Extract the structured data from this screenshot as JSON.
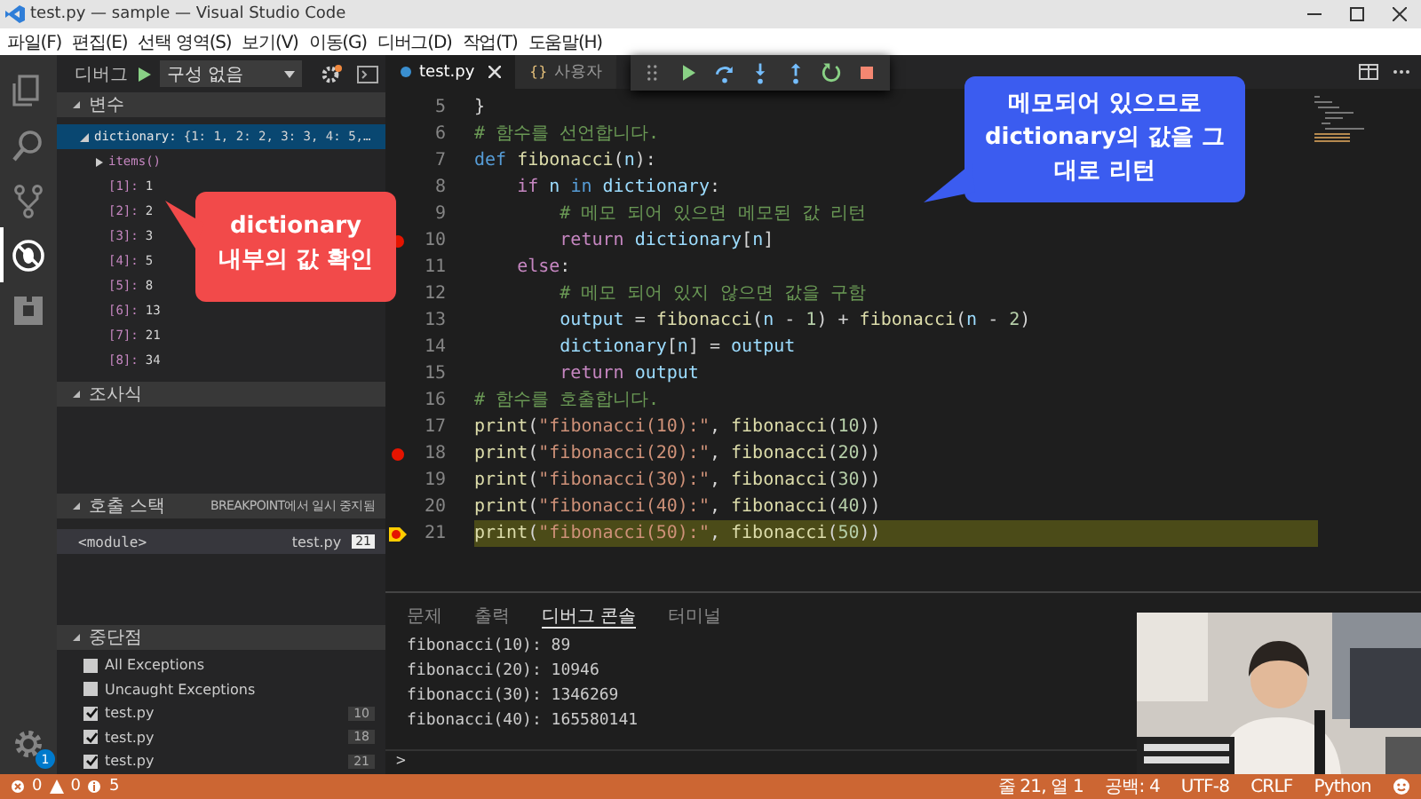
{
  "window": {
    "title": "test.py — sample — Visual Studio Code"
  },
  "menu": [
    "파일(F)",
    "편집(E)",
    "선택 영역(S)",
    "보기(V)",
    "이동(G)",
    "디버그(D)",
    "작업(T)",
    "도움말(H)"
  ],
  "activity_bar": {
    "items": [
      {
        "kind": "explorer",
        "selected": false
      },
      {
        "kind": "search",
        "selected": false
      },
      {
        "kind": "source-control",
        "selected": false
      },
      {
        "kind": "debug",
        "selected": true
      },
      {
        "kind": "extensions",
        "selected": false
      }
    ],
    "settings_badge": "1"
  },
  "debug_sidebar": {
    "label": "디버그",
    "configuration": "구성 없음",
    "variables": {
      "title": "변수",
      "items": [
        {
          "name": "dictionary:",
          "value": "{1: 1, 2: 2, 3: 3, 4: 5,…",
          "expanded": true,
          "selected": true,
          "children": [
            {
              "name": "items()",
              "expanded": false,
              "selected": false
            },
            {
              "name": "[1]:",
              "value": "1",
              "selected": false
            },
            {
              "name": "[2]:",
              "value": "2",
              "selected": false
            },
            {
              "name": "[3]:",
              "value": "3",
              "selected": false
            },
            {
              "name": "[4]:",
              "value": "5",
              "selected": false
            },
            {
              "name": "[5]:",
              "value": "8",
              "selected": false
            },
            {
              "name": "[6]:",
              "value": "13",
              "selected": false
            },
            {
              "name": "[7]:",
              "value": "21",
              "selected": false
            },
            {
              "name": "[8]:",
              "value": "34",
              "selected": false
            }
          ]
        }
      ]
    },
    "watch": {
      "title": "조사식"
    },
    "call_stack": {
      "title": "호출 스택",
      "status": "BREAKPOINT에서 일시 중지됨",
      "frames": [
        {
          "name": "<module>",
          "file": "test.py",
          "line": "21",
          "selected": true
        }
      ]
    },
    "breakpoints": {
      "title": "중단점",
      "items": [
        {
          "label": "All Exceptions",
          "checked": false
        },
        {
          "label": "Uncaught Exceptions",
          "checked": false
        },
        {
          "label": "test.py",
          "line": "10",
          "checked": true
        },
        {
          "label": "test.py",
          "line": "18",
          "checked": true
        },
        {
          "label": "test.py",
          "line": "21",
          "checked": true
        }
      ]
    }
  },
  "editor": {
    "tabs": [
      {
        "label": "test.py",
        "kind": "python-file",
        "selected": true
      },
      {
        "label": "사용자",
        "kind": "settings-file",
        "glyph": "{}",
        "selected": false
      }
    ],
    "debug_toolbar": [
      {
        "kind": "grip"
      },
      {
        "kind": "continue"
      },
      {
        "kind": "step-over"
      },
      {
        "kind": "step-into"
      },
      {
        "kind": "step-out"
      },
      {
        "kind": "restart"
      },
      {
        "kind": "stop"
      }
    ],
    "lines": [
      {
        "number": "5",
        "breakpoint": false,
        "current": false,
        "tokens": [
          {
            "kind": "plain",
            "text": "}"
          }
        ]
      },
      {
        "number": "6",
        "breakpoint": false,
        "current": false,
        "tokens": [
          {
            "kind": "comment",
            "text": "# 함수를 선언합니다."
          }
        ]
      },
      {
        "number": "7",
        "breakpoint": false,
        "current": false,
        "tokens": [
          {
            "kind": "storage",
            "text": "def"
          },
          {
            "kind": "function",
            "text": " fibonacci"
          },
          {
            "kind": "plain",
            "text": "("
          },
          {
            "kind": "variable",
            "text": "n"
          },
          {
            "kind": "plain",
            "text": "):"
          }
        ]
      },
      {
        "number": "8",
        "breakpoint": false,
        "current": false,
        "tokens": [
          {
            "kind": "keyword",
            "text": "    if"
          },
          {
            "kind": "variable",
            "text": " n"
          },
          {
            "kind": "storage",
            "text": " in"
          },
          {
            "kind": "variable",
            "text": " dictionary"
          },
          {
            "kind": "plain",
            "text": ":"
          }
        ]
      },
      {
        "number": "9",
        "breakpoint": false,
        "current": false,
        "tokens": [
          {
            "kind": "comment",
            "text": "        # 메모 되어 있으면 메모된 값 리턴"
          }
        ]
      },
      {
        "number": "10",
        "breakpoint": true,
        "current": false,
        "tokens": [
          {
            "kind": "keyword",
            "text": "        return"
          },
          {
            "kind": "variable",
            "text": " dictionary"
          },
          {
            "kind": "plain",
            "text": "["
          },
          {
            "kind": "variable",
            "text": "n"
          },
          {
            "kind": "plain",
            "text": "]"
          }
        ]
      },
      {
        "number": "11",
        "breakpoint": false,
        "current": false,
        "tokens": [
          {
            "kind": "keyword",
            "text": "    else"
          },
          {
            "kind": "plain",
            "text": ":"
          }
        ]
      },
      {
        "number": "12",
        "breakpoint": false,
        "current": false,
        "tokens": [
          {
            "kind": "comment",
            "text": "        # 메모 되어 있지 않으면 값을 구함"
          }
        ]
      },
      {
        "number": "13",
        "breakpoint": false,
        "current": false,
        "tokens": [
          {
            "kind": "variable",
            "text": "        output"
          },
          {
            "kind": "plain",
            "text": " = "
          },
          {
            "kind": "function",
            "text": "fibonacci"
          },
          {
            "kind": "plain",
            "text": "("
          },
          {
            "kind": "variable",
            "text": "n"
          },
          {
            "kind": "plain",
            "text": " - "
          },
          {
            "kind": "number",
            "text": "1"
          },
          {
            "kind": "plain",
            "text": ") + "
          },
          {
            "kind": "function",
            "text": "fibonacci"
          },
          {
            "kind": "plain",
            "text": "("
          },
          {
            "kind": "variable",
            "text": "n"
          },
          {
            "kind": "plain",
            "text": " - "
          },
          {
            "kind": "number",
            "text": "2"
          },
          {
            "kind": "plain",
            "text": ")"
          }
        ]
      },
      {
        "number": "14",
        "breakpoint": false,
        "current": false,
        "tokens": [
          {
            "kind": "variable",
            "text": "        dictionary"
          },
          {
            "kind": "plain",
            "text": "["
          },
          {
            "kind": "variable",
            "text": "n"
          },
          {
            "kind": "plain",
            "text": "] = "
          },
          {
            "kind": "variable",
            "text": "output"
          }
        ]
      },
      {
        "number": "15",
        "breakpoint": false,
        "current": false,
        "tokens": [
          {
            "kind": "keyword",
            "text": "        return"
          },
          {
            "kind": "variable",
            "text": " output"
          }
        ]
      },
      {
        "number": "16",
        "breakpoint": false,
        "current": false,
        "tokens": [
          {
            "kind": "comment",
            "text": "# 함수를 호출합니다."
          }
        ]
      },
      {
        "number": "17",
        "breakpoint": false,
        "current": false,
        "tokens": [
          {
            "kind": "function",
            "text": "print"
          },
          {
            "kind": "plain",
            "text": "("
          },
          {
            "kind": "string",
            "text": "\"fibonacci(10):\""
          },
          {
            "kind": "plain",
            "text": ", "
          },
          {
            "kind": "function",
            "text": "fibonacci"
          },
          {
            "kind": "plain",
            "text": "("
          },
          {
            "kind": "number",
            "text": "10"
          },
          {
            "kind": "plain",
            "text": "))"
          }
        ]
      },
      {
        "number": "18",
        "breakpoint": true,
        "current": false,
        "tokens": [
          {
            "kind": "function",
            "text": "print"
          },
          {
            "kind": "plain",
            "text": "("
          },
          {
            "kind": "string",
            "text": "\"fibonacci(20):\""
          },
          {
            "kind": "plain",
            "text": ", "
          },
          {
            "kind": "function",
            "text": "fibonacci"
          },
          {
            "kind": "plain",
            "text": "("
          },
          {
            "kind": "number",
            "text": "20"
          },
          {
            "kind": "plain",
            "text": "))"
          }
        ]
      },
      {
        "number": "19",
        "breakpoint": false,
        "current": false,
        "tokens": [
          {
            "kind": "function",
            "text": "print"
          },
          {
            "kind": "plain",
            "text": "("
          },
          {
            "kind": "string",
            "text": "\"fibonacci(30):\""
          },
          {
            "kind": "plain",
            "text": ", "
          },
          {
            "kind": "function",
            "text": "fibonacci"
          },
          {
            "kind": "plain",
            "text": "("
          },
          {
            "kind": "number",
            "text": "30"
          },
          {
            "kind": "plain",
            "text": "))"
          }
        ]
      },
      {
        "number": "20",
        "breakpoint": false,
        "current": false,
        "tokens": [
          {
            "kind": "function",
            "text": "print"
          },
          {
            "kind": "plain",
            "text": "("
          },
          {
            "kind": "string",
            "text": "\"fibonacci(40):\""
          },
          {
            "kind": "plain",
            "text": ", "
          },
          {
            "kind": "function",
            "text": "fibonacci"
          },
          {
            "kind": "plain",
            "text": "("
          },
          {
            "kind": "number",
            "text": "40"
          },
          {
            "kind": "plain",
            "text": "))"
          }
        ]
      },
      {
        "number": "21",
        "breakpoint": true,
        "current": true,
        "tokens": [
          {
            "kind": "function",
            "text": "print"
          },
          {
            "kind": "plain",
            "text": "("
          },
          {
            "kind": "string",
            "text": "\"fibonacci(50):\""
          },
          {
            "kind": "plain",
            "text": ", "
          },
          {
            "kind": "function",
            "text": "fibonacci"
          },
          {
            "kind": "plain",
            "text": "("
          },
          {
            "kind": "number",
            "text": "50"
          },
          {
            "kind": "plain",
            "text": "))"
          }
        ]
      }
    ]
  },
  "annotations": [
    {
      "text": "dictionary\n내부의 값 확인",
      "color": "#f24a4a"
    },
    {
      "text": "메모되어 있으므로\ndictionary의 값을 그\n대로 리턴",
      "color": "#3b5cf0"
    }
  ],
  "panel": {
    "tabs": [
      {
        "label": "문제",
        "selected": false
      },
      {
        "label": "출력",
        "selected": false
      },
      {
        "label": "디버그 콘솔",
        "selected": true
      },
      {
        "label": "터미널",
        "selected": false
      }
    ],
    "output": [
      "fibonacci(10): 89",
      "fibonacci(20): 10946",
      "fibonacci(30): 1346269",
      "fibonacci(40): 165580141"
    ],
    "prompt": ">"
  },
  "webcam": {
    "kind": "picture"
  },
  "status_bar": {
    "errors": "0",
    "warnings": "0",
    "infos": "5",
    "items": [
      "줄 21, 열 1",
      "공백: 4",
      "UTF-8",
      "CRLF",
      "Python"
    ]
  }
}
